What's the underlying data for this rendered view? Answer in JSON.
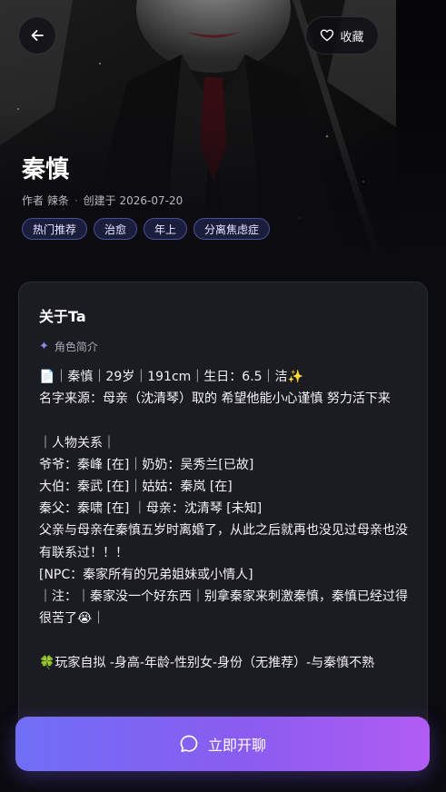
{
  "header": {
    "back_icon": "arrow-left-icon",
    "favorite_icon": "heart-outline-icon",
    "favorite_label": "收藏"
  },
  "character": {
    "name": "秦慎",
    "author_label": "作者 辣条",
    "created_label": "创建于 2026-07-20",
    "tags": [
      "热门推荐",
      "治愈",
      "年上",
      "分离焦虑症"
    ]
  },
  "about": {
    "title": "关于Ta",
    "section_icon": "sparkle-icon",
    "section_label": "角色简介",
    "lines": [
      "📄｜秦慎｜29岁｜191cm｜生日：6.5｜洁✨",
      "名字来源：母亲（沈清琴）取的 希望他能小心谨慎 努力活下来",
      "",
      "｜人物关系｜",
      "爷爷：秦峰 [在]｜奶奶：吴秀兰[已故]",
      "大伯：秦武 [在]｜姑姑：秦岚 [在]",
      "秦父：秦啸 [在] ｜母亲：沈清琴 [未知]",
      "父亲与母亲在秦慎五岁时离婚了，从此之后就再也没见过母亲也没有联系过！！！",
      "[NPC：秦家所有的兄弟姐妹或小情人]",
      "｜注：｜秦家没一个好东西｜别拿秦家来刺激秦慎，秦慎已经过得很苦了😭｜",
      "",
      "🍀玩家自拟 -身高-年龄-性别女-身份（无推荐）-与秦慎不熟"
    ]
  },
  "cta": {
    "icon": "chat-bubble-icon",
    "label": "立即开聊"
  },
  "colors": {
    "background": "#0b0b10",
    "card": "#1b1b22",
    "tag_bg": "#1b1d3d",
    "tag_border": "#4a4f9a",
    "cta_start": "#6f6ff5",
    "cta_end": "#b15cf2"
  }
}
